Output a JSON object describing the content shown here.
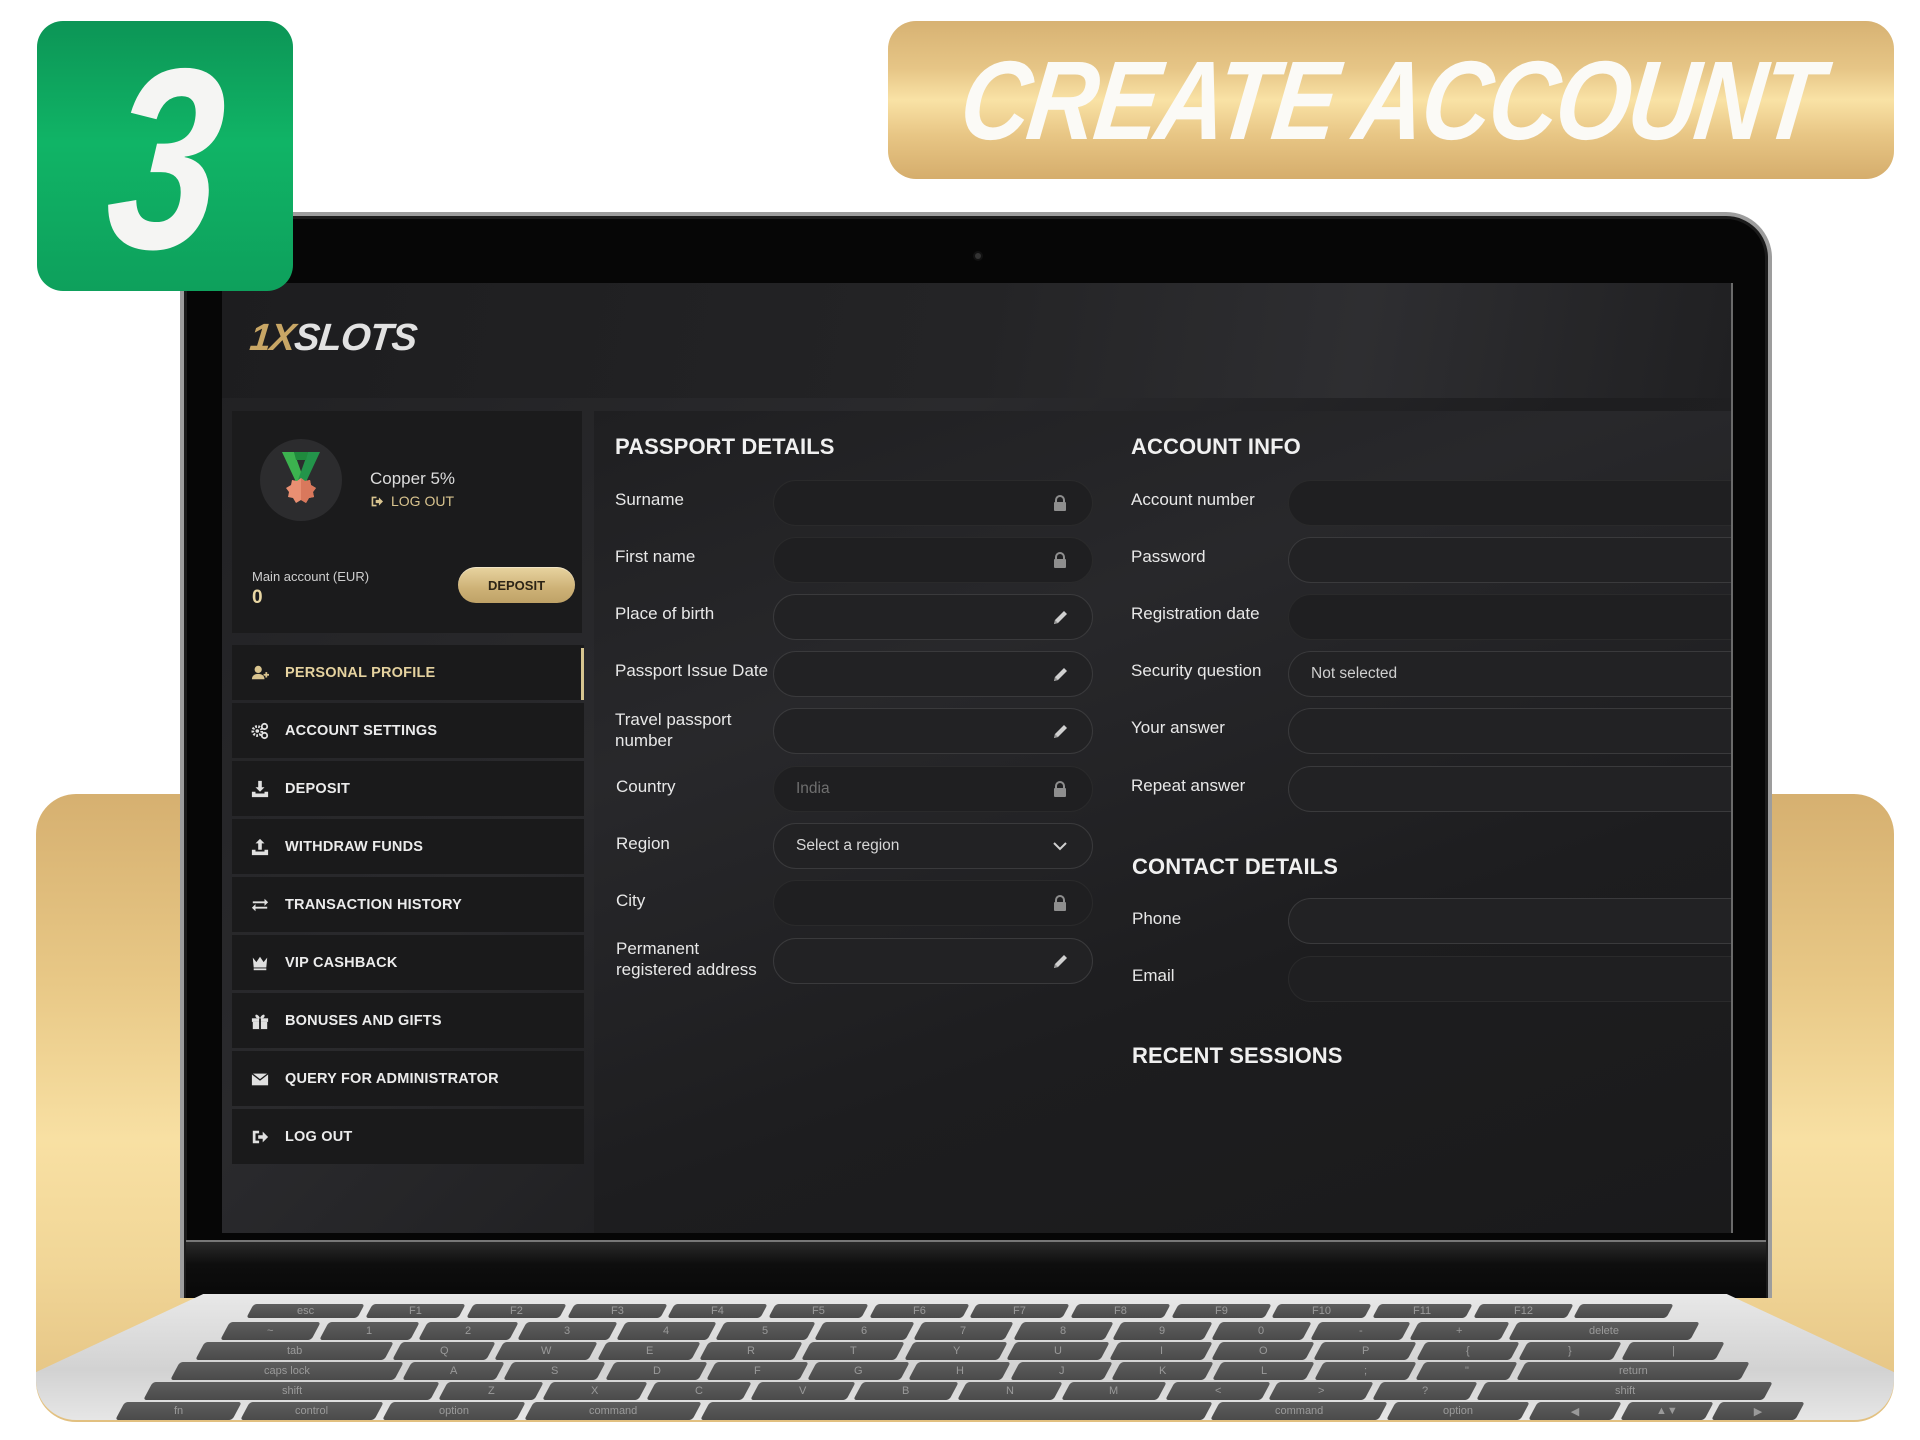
{
  "step": {
    "number": "3",
    "color": "#10b466"
  },
  "banner": {
    "title": "CREATE ACCOUNT",
    "accent": "#e6c586"
  },
  "site": {
    "logo_part1": "1X",
    "logo_part2": "SLOTS",
    "accent_gold": "#d7c58f"
  },
  "profile": {
    "avatar_icon": "copper-medal-icon",
    "tier": "Copper 5%",
    "logout_label": "LOG OUT",
    "account_label": "Main account (EUR)",
    "balance": "0",
    "deposit_label": "DEPOSIT"
  },
  "sidebar": {
    "items": [
      {
        "label": "PERSONAL PROFILE",
        "icon": "user-plus-icon",
        "active": true
      },
      {
        "label": "ACCOUNT SETTINGS",
        "icon": "gears-icon",
        "active": false
      },
      {
        "label": "DEPOSIT",
        "icon": "download-tray-icon",
        "active": false
      },
      {
        "label": "WITHDRAW FUNDS",
        "icon": "upload-tray-icon",
        "active": false
      },
      {
        "label": "TRANSACTION HISTORY",
        "icon": "transfer-arrows-icon",
        "active": false
      },
      {
        "label": "VIP CASHBACK",
        "icon": "crown-icon",
        "active": false
      },
      {
        "label": "BONUSES AND GIFTS",
        "icon": "gift-icon",
        "active": false
      },
      {
        "label": "QUERY FOR ADMINISTRATOR",
        "icon": "envelope-icon",
        "active": false
      },
      {
        "label": "LOG OUT",
        "icon": "logout-icon",
        "active": false
      }
    ]
  },
  "passport": {
    "title": "PASSPORT DETAILS",
    "fields": [
      {
        "label": "Surname",
        "value": "",
        "state": "locked"
      },
      {
        "label": "First name",
        "value": "",
        "state": "locked"
      },
      {
        "label": "Place of birth",
        "value": "",
        "state": "editable"
      },
      {
        "label": "Passport Issue Date",
        "value": "",
        "state": "editable"
      },
      {
        "label": "Travel passport number",
        "value": "",
        "state": "editable"
      },
      {
        "label": "Country",
        "value": "India",
        "state": "locked"
      },
      {
        "label": "Region",
        "value": "Select a region",
        "state": "dropdown"
      },
      {
        "label": "City",
        "value": "",
        "state": "locked"
      },
      {
        "label": "Permanent registered address",
        "value": "",
        "state": "editable"
      }
    ]
  },
  "account_info": {
    "title": "ACCOUNT INFO",
    "fields": [
      {
        "label": "Account number",
        "value": ""
      },
      {
        "label": "Password",
        "value": ""
      },
      {
        "label": "Registration date",
        "value": ""
      },
      {
        "label": "Security question",
        "value": "Not selected"
      },
      {
        "label": "Your answer",
        "value": ""
      },
      {
        "label": "Repeat answer",
        "value": ""
      }
    ]
  },
  "contact": {
    "title": "CONTACT DETAILS",
    "fields": [
      {
        "label": "Phone",
        "value": ""
      },
      {
        "label": "Email",
        "value": ""
      }
    ]
  },
  "sessions": {
    "title": "RECENT SESSIONS"
  },
  "keyboard": {
    "rows": [
      [
        "esc",
        "F1",
        "F2",
        "F3",
        "F4",
        "F5",
        "F6",
        "F7",
        "F8",
        "F9",
        "F10",
        "F11",
        "F12",
        ""
      ],
      [
        "~",
        "1",
        "2",
        "3",
        "4",
        "5",
        "6",
        "7",
        "8",
        "9",
        "0",
        "-",
        "+",
        "delete"
      ],
      [
        "tab",
        "Q",
        "W",
        "E",
        "R",
        "T",
        "Y",
        "U",
        "I",
        "O",
        "P",
        "{",
        "}",
        "|"
      ],
      [
        "caps lock",
        "A",
        "S",
        "D",
        "F",
        "G",
        "H",
        "J",
        "K",
        "L",
        ";",
        "\"",
        "return"
      ],
      [
        "shift",
        "Z",
        "X",
        "C",
        "V",
        "B",
        "N",
        "M",
        "<",
        ">",
        "?",
        "shift"
      ],
      [
        "fn",
        "control",
        "option",
        "command",
        "",
        "command",
        "option",
        "◀",
        "▲▼",
        "▶"
      ]
    ]
  }
}
